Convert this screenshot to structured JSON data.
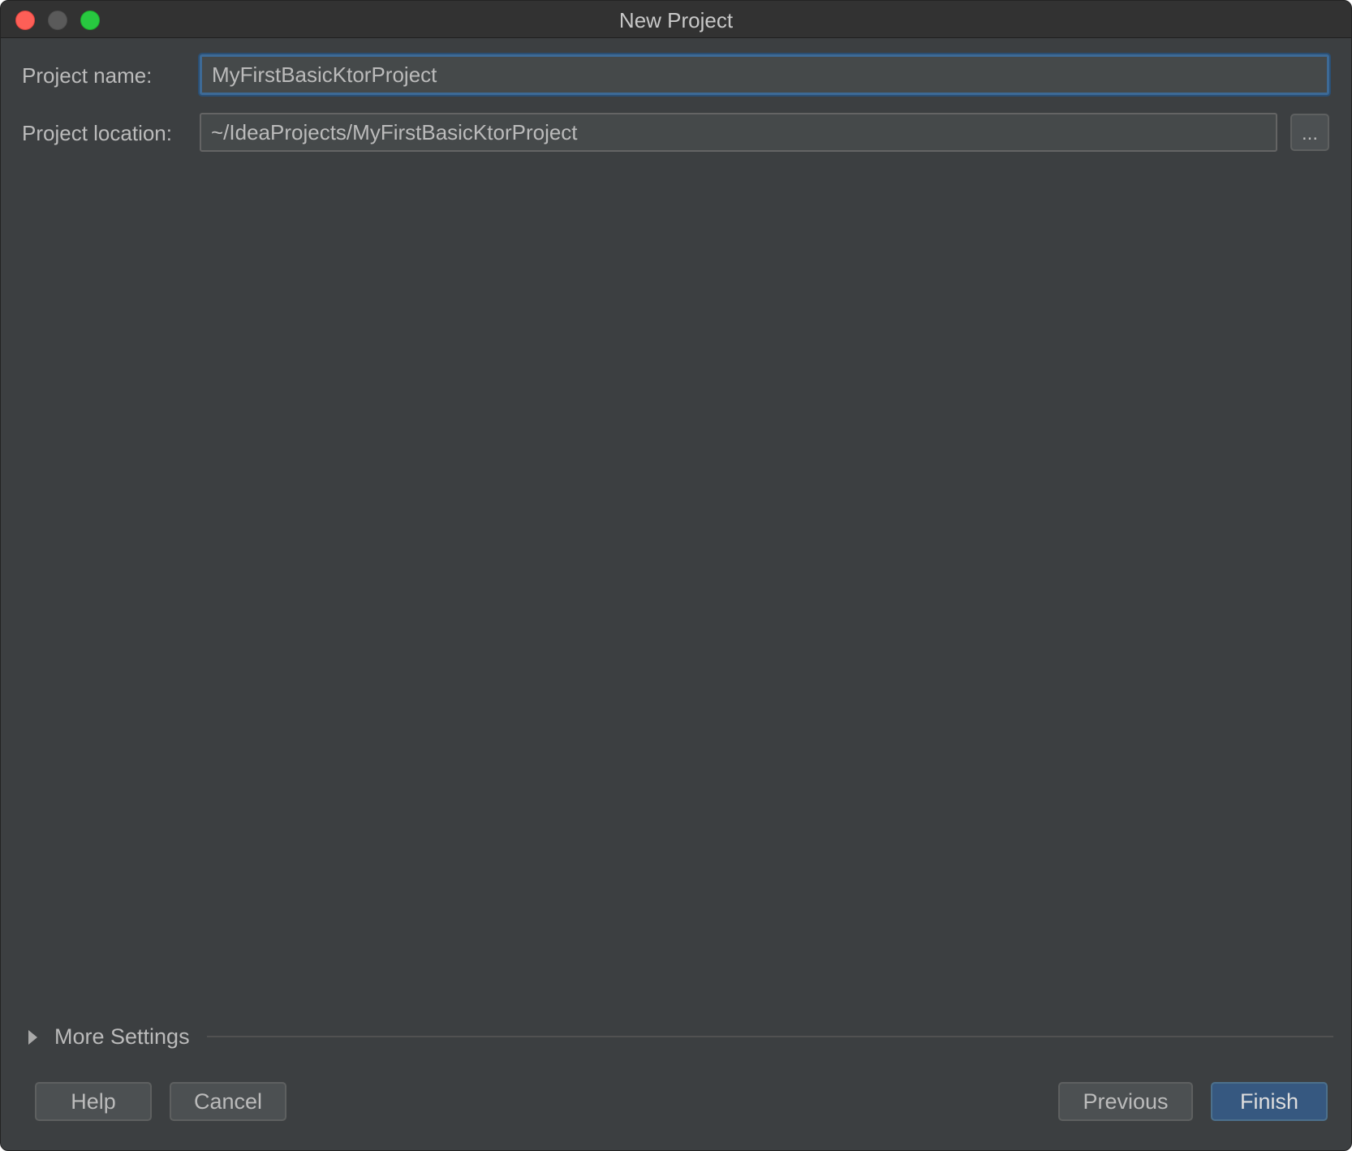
{
  "window": {
    "title": "New Project"
  },
  "form": {
    "project_name_label": "Project name:",
    "project_name_value": "MyFirstBasicKtorProject",
    "project_location_label": "Project location:",
    "project_location_value": "~/IdeaProjects/MyFirstBasicKtorProject",
    "browse_label": "..."
  },
  "more_settings": {
    "label": "More Settings",
    "expanded": false
  },
  "footer": {
    "help_label": "Help",
    "cancel_label": "Cancel",
    "previous_label": "Previous",
    "finish_label": "Finish"
  },
  "colors": {
    "background": "#3c3f41",
    "field": "#45494a",
    "focus_border": "#3d6a96",
    "primary_button": "#365880"
  }
}
